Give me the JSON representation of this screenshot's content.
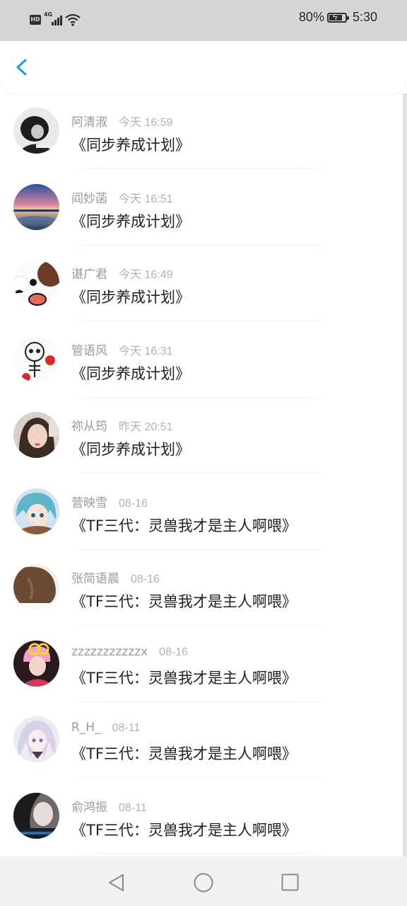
{
  "status_bar": {
    "network": "4G",
    "hd": "HD",
    "battery_percent": "80%",
    "battery_level": 0.8,
    "time": "5:30"
  },
  "header": {
    "back_icon": "chevron-left-icon",
    "accent_color": "#1a9be6"
  },
  "messages": [
    {
      "name": "阿清淑",
      "time": "今天 16:59",
      "title": "《同步养成计划》",
      "avatar": "bw-portrait"
    },
    {
      "name": "阎妙菡",
      "time": "今天 16:51",
      "title": "《同步养成计划》",
      "avatar": "sunset-lake"
    },
    {
      "name": "谌广君",
      "time": "今天 16:49",
      "title": "《同步养成计划》",
      "avatar": "cartoon-dog"
    },
    {
      "name": "管语风",
      "time": "今天 16:31",
      "title": "《同步养成计划》",
      "avatar": "skeleton-boxer"
    },
    {
      "name": "祢从筠",
      "time": "昨天 20:51",
      "title": "《同步养成计划》",
      "avatar": "girl-portrait"
    },
    {
      "name": "营映雪",
      "time": "08-16",
      "title": "《TF三代：灵兽我才是主人啊喂》",
      "avatar": "anime-blue-hair"
    },
    {
      "name": "张简语晨",
      "time": "08-16",
      "title": "《TF三代：灵兽我才是主人啊喂》",
      "avatar": "brown-hair"
    },
    {
      "name": "zzzzzzzzzzzx",
      "time": "08-16",
      "title": "《TF三代：灵兽我才是主人啊喂》",
      "avatar": "pink-hair-boy"
    },
    {
      "name": "R_H_",
      "time": "08-11",
      "title": "《TF三代：灵兽我才是主人啊喂》",
      "avatar": "anime-silver-hair"
    },
    {
      "name": "俞鸿振",
      "time": "08-11",
      "title": "《TF三代：灵兽我才是主人啊喂》",
      "avatar": "dark-portrait"
    }
  ],
  "nav_bar": {
    "back_icon": "triangle-back-icon",
    "home_icon": "circle-home-icon",
    "recents_icon": "square-recents-icon"
  }
}
